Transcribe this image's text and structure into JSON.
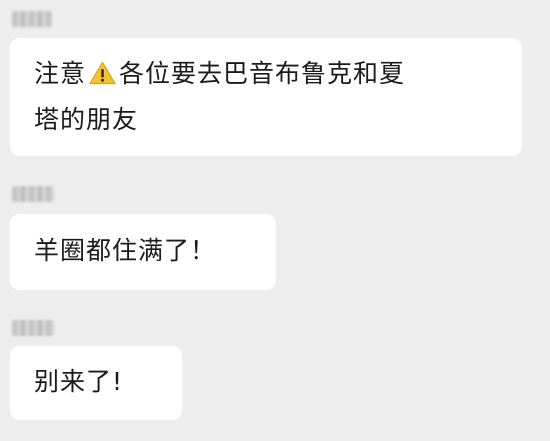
{
  "messages": [
    {
      "sender": "",
      "text_before_icon": "注意",
      "icon": "warning-icon",
      "text_after_icon": "各位要去巴音布鲁克和夏\n塔的朋友"
    },
    {
      "sender": "",
      "text": "羊圈都住满了！"
    },
    {
      "sender": "",
      "text": "别来了!"
    }
  ],
  "colors": {
    "background": "#ededed",
    "bubble": "#ffffff",
    "text": "#1b1b1b",
    "warning_fill": "#f4c430"
  }
}
